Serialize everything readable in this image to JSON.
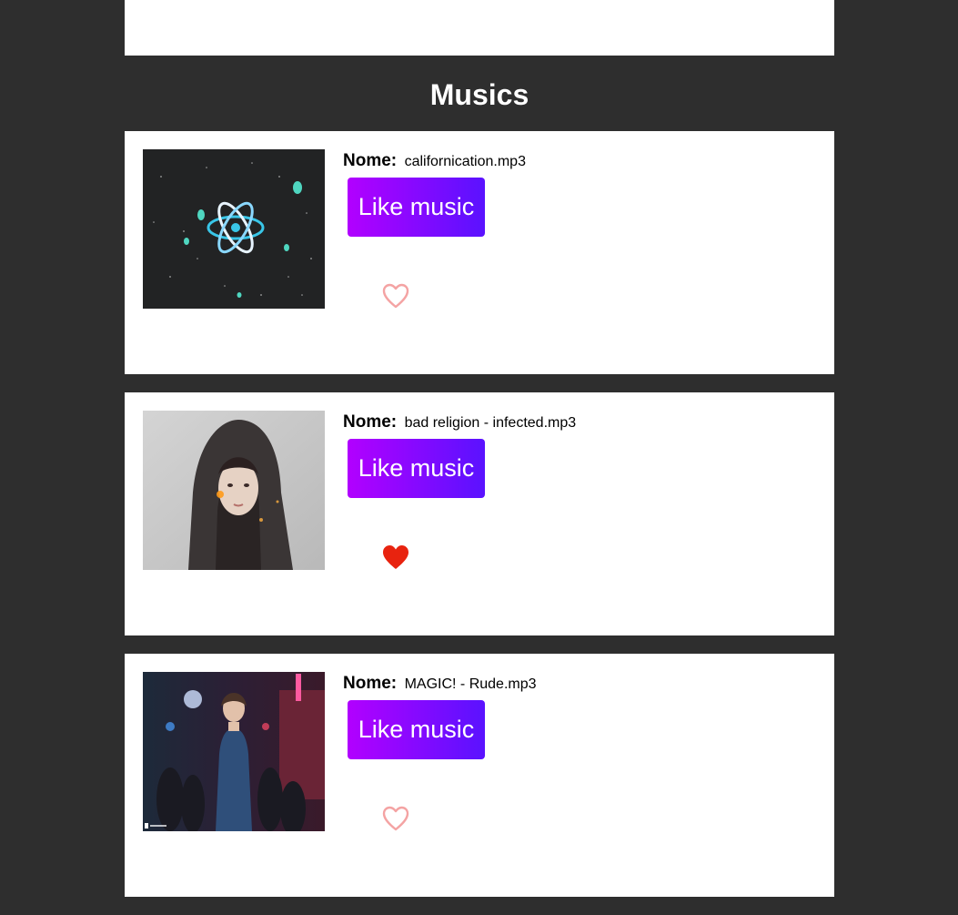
{
  "page": {
    "section_title": "Musics"
  },
  "musics": [
    {
      "name_label": "Nome:",
      "name_value": "californication.mp3",
      "button_label": "Like music",
      "liked": false,
      "heart_color": "#f4a3a3",
      "thumbnail": "react-atom-artwork"
    },
    {
      "name_label": "Nome:",
      "name_value": "bad religion - infected.mp3",
      "button_label": "Like music",
      "liked": true,
      "heart_color": "#e8230f",
      "thumbnail": "hooded-girl-artwork"
    },
    {
      "name_label": "Nome:",
      "name_value": "MAGIC! - Rude.mp3",
      "button_label": "Like music",
      "liked": false,
      "heart_color": "#f4a3a3",
      "thumbnail": "city-night-character-artwork"
    }
  ],
  "colors": {
    "background": "#2e2e2e",
    "card": "#ffffff",
    "button_gradient_start": "#b200ff",
    "button_gradient_end": "#5a12ff"
  }
}
